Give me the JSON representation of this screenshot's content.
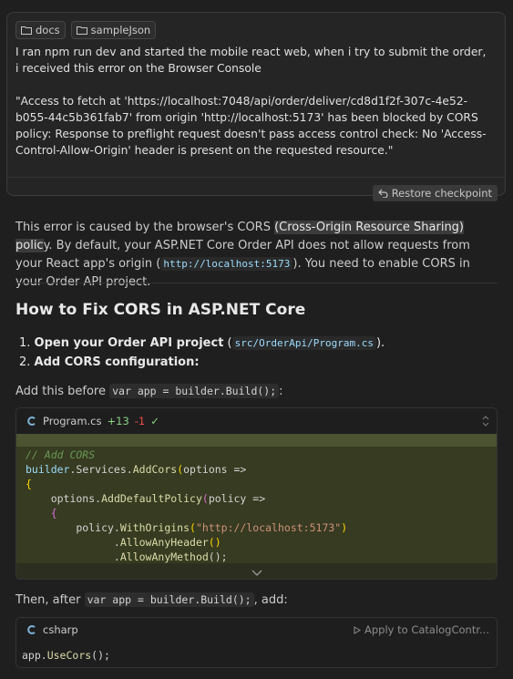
{
  "user_message": {
    "chips": [
      {
        "icon": "folder-icon",
        "label": "docs"
      },
      {
        "icon": "folder-icon",
        "label": "sampleJson"
      }
    ],
    "paragraph1": "I ran npm run dev and started the mobile react web, when i try to submit the order, i received this error on the Browser Console",
    "paragraph2": "\"Access to fetch at 'https://localhost:7048/api/order/deliver/cd8d1f2f-307c-4e52-b055-44c5b361fab7' from origin 'http://localhost:5173' has been blocked by CORS policy: Response to preflight request doesn't pass access control check: No 'Access-Control-Allow-Origin' header is present on the requested resource.\"",
    "restore_label": "Restore checkpoint"
  },
  "answer": {
    "intro_a": "This error is caused by the browser's CORS ",
    "intro_hl": "(Cross-Origin Resource Sharing) polic",
    "intro_b": "y. By default, your ASP.NET Core Order API does not allow requests from your React app's origin (",
    "origin_code": "http://localhost:5173",
    "intro_c": "). You need to enable CORS in your Order API project.",
    "heading": "How to Fix CORS in ASP.NET Core",
    "step1_num": "1.",
    "step1_bold": "Open your Order API project",
    "step1_pre": " (",
    "step1_code": "src/OrderApi/Program.cs",
    "step1_post": ").",
    "step2_num": "2.",
    "step2_bold": "Add CORS configuration:",
    "before_a": "Add this before ",
    "before_code": "var app = builder.Build();",
    "before_b": ":",
    "code_block": {
      "filename": "Program.cs",
      "added": "+13",
      "removed": "-1",
      "check": "✓"
    },
    "then_a": "Then, after ",
    "then_code": "var app = builder.Build();",
    "then_b": ", add:",
    "csharp_block": {
      "lang": "csharp",
      "apply_label": "Apply to CatalogContr...",
      "code_obj": "app.",
      "code_fn": "UseCors",
      "code_tail": "();"
    }
  },
  "colors": {
    "background": "#1f1f1f",
    "code_added_bg": "#363b21",
    "accent_green": "#89d185",
    "accent_red": "#f14c4c"
  }
}
